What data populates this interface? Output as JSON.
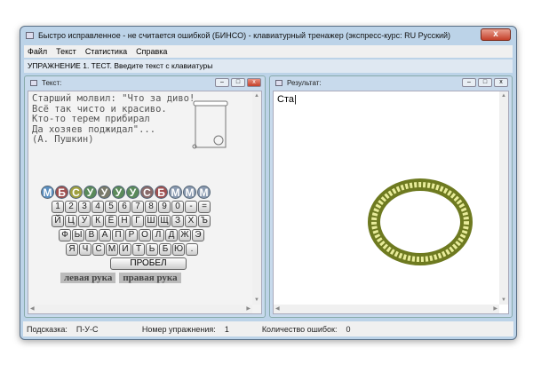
{
  "window": {
    "title": "Быстро исправленное - не считается ошибкой (БИНСО) - клавиатурный тренажер (экспресс-курс: RU Русский)",
    "close": "x"
  },
  "menu": [
    "Файл",
    "Текст",
    "Статистика",
    "Справка"
  ],
  "exercise_label": "УПРАЖНЕНИЕ 1. ТЕСТ. Введите текст с клавиатуры",
  "text_pane": {
    "title": "Текст:",
    "poem": "Старший молвил: \"Что за диво!\nВсё так чисто и красиво.\nКто-то терем прибирал\nДа хозяев поджидал\"...\n(А. Пушкин)"
  },
  "keyboard": {
    "fingers": [
      "М",
      "Б",
      "С",
      "У",
      "У",
      "У",
      "У",
      "С",
      "Б",
      "М",
      "М",
      "М"
    ],
    "rows": [
      [
        "1",
        "2",
        "3",
        "4",
        "5",
        "6",
        "7",
        "8",
        "9",
        "0",
        "-",
        "="
      ],
      [
        "Й",
        "Ц",
        "У",
        "К",
        "Ё",
        "Н",
        "Г",
        "Ш",
        "Щ",
        "З",
        "Х",
        "Ъ"
      ],
      [
        "Ф",
        "Ы",
        "В",
        "А",
        "П",
        "Р",
        "О",
        "Л",
        "Д",
        "Ж",
        "Э"
      ],
      [
        "Я",
        "Ч",
        "С",
        "М",
        "И",
        "Т",
        "Ь",
        "Б",
        "Ю",
        "."
      ]
    ],
    "space": "ПРОБЕЛ",
    "left_hand": "левая рука",
    "right_hand": "правая рука"
  },
  "result_pane": {
    "title": "Результат:",
    "typed": "Ста"
  },
  "status": {
    "hint_label": "Подсказка:",
    "hint": "П-У-С",
    "exercise_label": "Номер упражнения:",
    "exercise": "1",
    "errors_label": "Количество ошибок:",
    "errors": "0"
  }
}
